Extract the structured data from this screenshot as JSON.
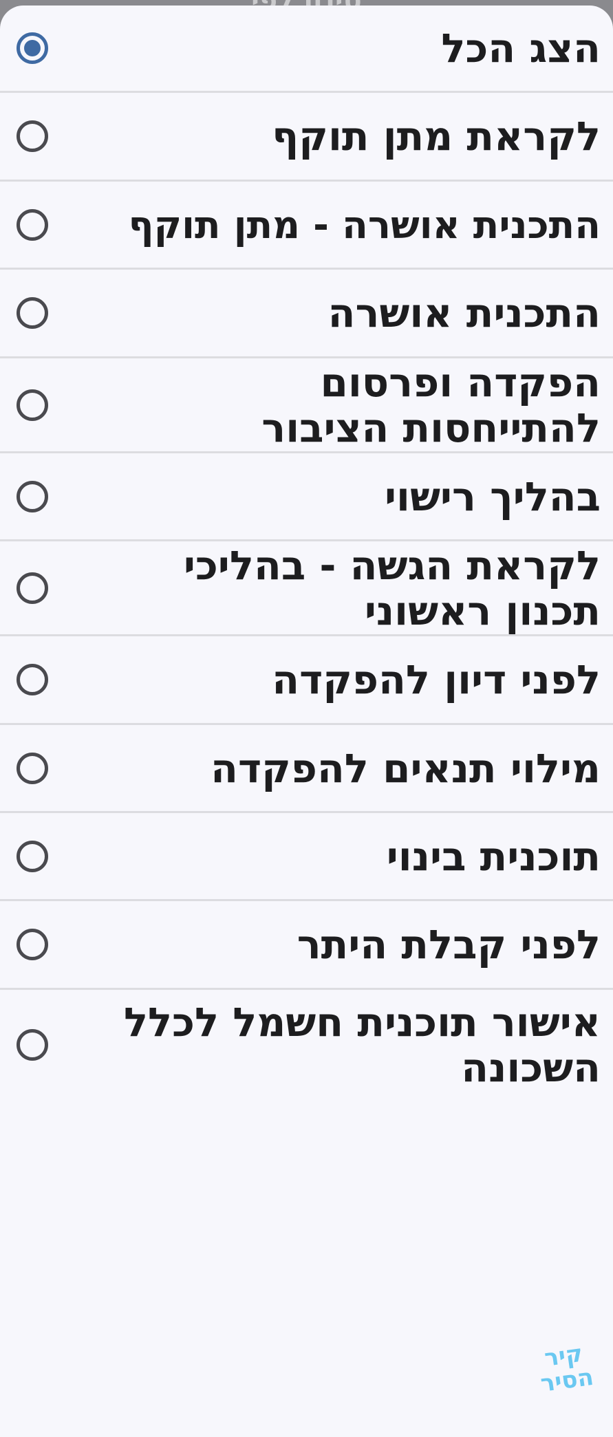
{
  "header": {
    "peek_title": "סינון לפי"
  },
  "options": [
    {
      "label": "הצג הכל",
      "selected": true
    },
    {
      "label": "לקראת מתן תוקף",
      "selected": false
    },
    {
      "label": "התכנית אושרה - מתן תוקף",
      "selected": false
    },
    {
      "label": "התכנית אושרה",
      "selected": false
    },
    {
      "label": "הפקדה ופרסום להתייחסות הציבור",
      "selected": false
    },
    {
      "label": "בהליך רישוי",
      "selected": false
    },
    {
      "label": "לקראת הגשה - בהליכי תכנון ראשוני",
      "selected": false
    },
    {
      "label": "לפני דיון להפקדה",
      "selected": false
    },
    {
      "label": "מילוי תנאים להפקדה",
      "selected": false
    },
    {
      "label": "תוכנית בינוי",
      "selected": false
    },
    {
      "label": "לפני קבלת היתר",
      "selected": false
    },
    {
      "label": "אישור תוכנית חשמל לכלל השכונה",
      "selected": false
    }
  ],
  "logo": {
    "text": "קיר הסיר"
  },
  "colors": {
    "accent": "#3f6aa3",
    "sheet_background": "#f7f7fc",
    "divider": "#dcdce0",
    "text": "#1d1d1f",
    "logo": "#5bc3f0"
  }
}
